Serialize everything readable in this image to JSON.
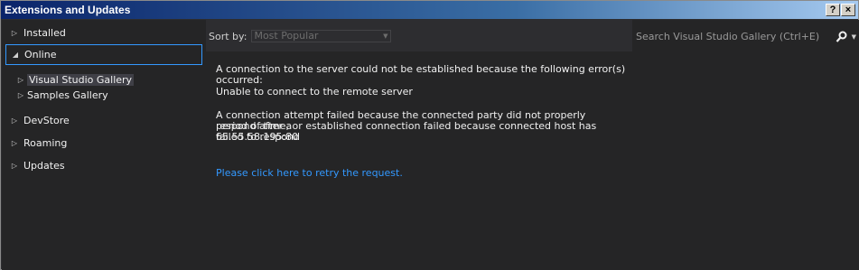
{
  "window": {
    "title": "Extensions and Updates",
    "help_label": "?",
    "close_label": "×"
  },
  "sidebar": {
    "items": [
      {
        "label": "Installed",
        "expanded": false
      },
      {
        "label": "Online",
        "expanded": true,
        "selected": true
      },
      {
        "label": "DevStore",
        "expanded": false
      },
      {
        "label": "Roaming",
        "expanded": false
      },
      {
        "label": "Updates",
        "expanded": false
      }
    ],
    "online_children": [
      {
        "label": "Visual Studio Gallery",
        "selected": true
      },
      {
        "label": "Samples Gallery",
        "selected": false
      }
    ]
  },
  "sort": {
    "label": "Sort by:",
    "value": "Most Popular"
  },
  "error": {
    "line1": "A connection to the server could not be established because the following error(s) occurred:",
    "line2": "Unable to connect to the remote server",
    "line3a": "A connection attempt failed because the connected party did not properly respond after a",
    "line3b": "period of time, or established connection failed because connected host has failed to respond",
    "line3c": "65.55.58.195:80",
    "retry": "Please click here to retry the request."
  },
  "search": {
    "placeholder": "Search Visual Studio Gallery (Ctrl+E)"
  },
  "colors": {
    "link": "#3399ff",
    "selection_border": "#3399ff",
    "panel_bg": "#252526",
    "window_bg": "#2d2d30"
  }
}
